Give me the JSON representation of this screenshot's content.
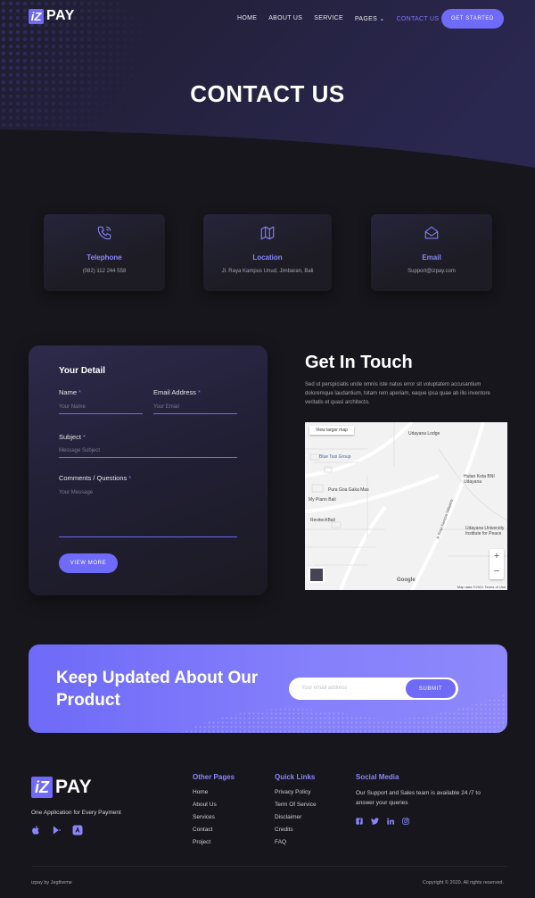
{
  "brand": {
    "logo_mark": "iZ",
    "logo_text": "PAY",
    "accent_color": "#6f6af8"
  },
  "nav": {
    "items": [
      "HOME",
      "ABOUT US",
      "SERVICE",
      "PAGES",
      "CONTACT US"
    ],
    "active": "CONTACT US",
    "cta": "GET STARTED"
  },
  "hero": {
    "title": "CONTACT US"
  },
  "cards": [
    {
      "icon": "phone-icon",
      "title": "Telephone",
      "text": "(082) 112 244 558"
    },
    {
      "icon": "map-icon",
      "title": "Location",
      "text": "Jl. Raya Kampus Unud, Jimbaran, Bali"
    },
    {
      "icon": "mail-icon",
      "title": "Email",
      "text": "Support@izpay.com"
    }
  ],
  "form": {
    "title": "Your Detail",
    "name_label": "Name",
    "name_placeholder": "Your Name",
    "email_label": "Email Address",
    "email_placeholder": "Your Email",
    "subject_label": "Subject",
    "subject_placeholder": "Message Subject",
    "comments_label": "Comments / Questions",
    "message_placeholder": "Your Message",
    "required_mark": "*",
    "submit": "VIEW MORE"
  },
  "contact": {
    "title": "Get In Touch",
    "text": "Sed ut perspiciatis unde omnis iste natus error sit voluptatem accusantium doloremque laudantium, totam rem aperiam, eaque ipsa quae ab illo inventore veritatis et quasi architecto."
  },
  "map": {
    "view_larger": "View larger map",
    "labels": [
      "Udayana Lodge",
      "Blue Taxi Group",
      "Pura Goa Gaka Mas",
      "My Piano Bali",
      "RevitechBali",
      "Hutan Kota BNI Udayana",
      "Udayana University Institute for Peace",
      "Jl. Raya Kampus Udayana"
    ],
    "zoom_in": "+",
    "zoom_out": "−",
    "google": "Google",
    "attribution": "Map data ©2021  Terms of Use"
  },
  "newsletter": {
    "title": "Keep Updated About Our Product",
    "email_placeholder": "Your email address",
    "submit": "SUBMIT"
  },
  "footer": {
    "tagline": "One Application for Every Payment",
    "other_pages_title": "Other Pages",
    "other_pages": [
      "Home",
      "About Us",
      "Services",
      "Contact",
      "Project"
    ],
    "quick_links_title": "Quick Links",
    "quick_links": [
      "Privacy Policy",
      "Term Of Service",
      "Disclaimer",
      "Credits",
      "FAQ"
    ],
    "social_title": "Social Media",
    "social_text": "Our Support and Sales team is available 24 /7 to answer your queries",
    "copyright_left": "izpay by Jegtheme",
    "copyright_right": "Copyright © 2020. All rights reserved."
  }
}
